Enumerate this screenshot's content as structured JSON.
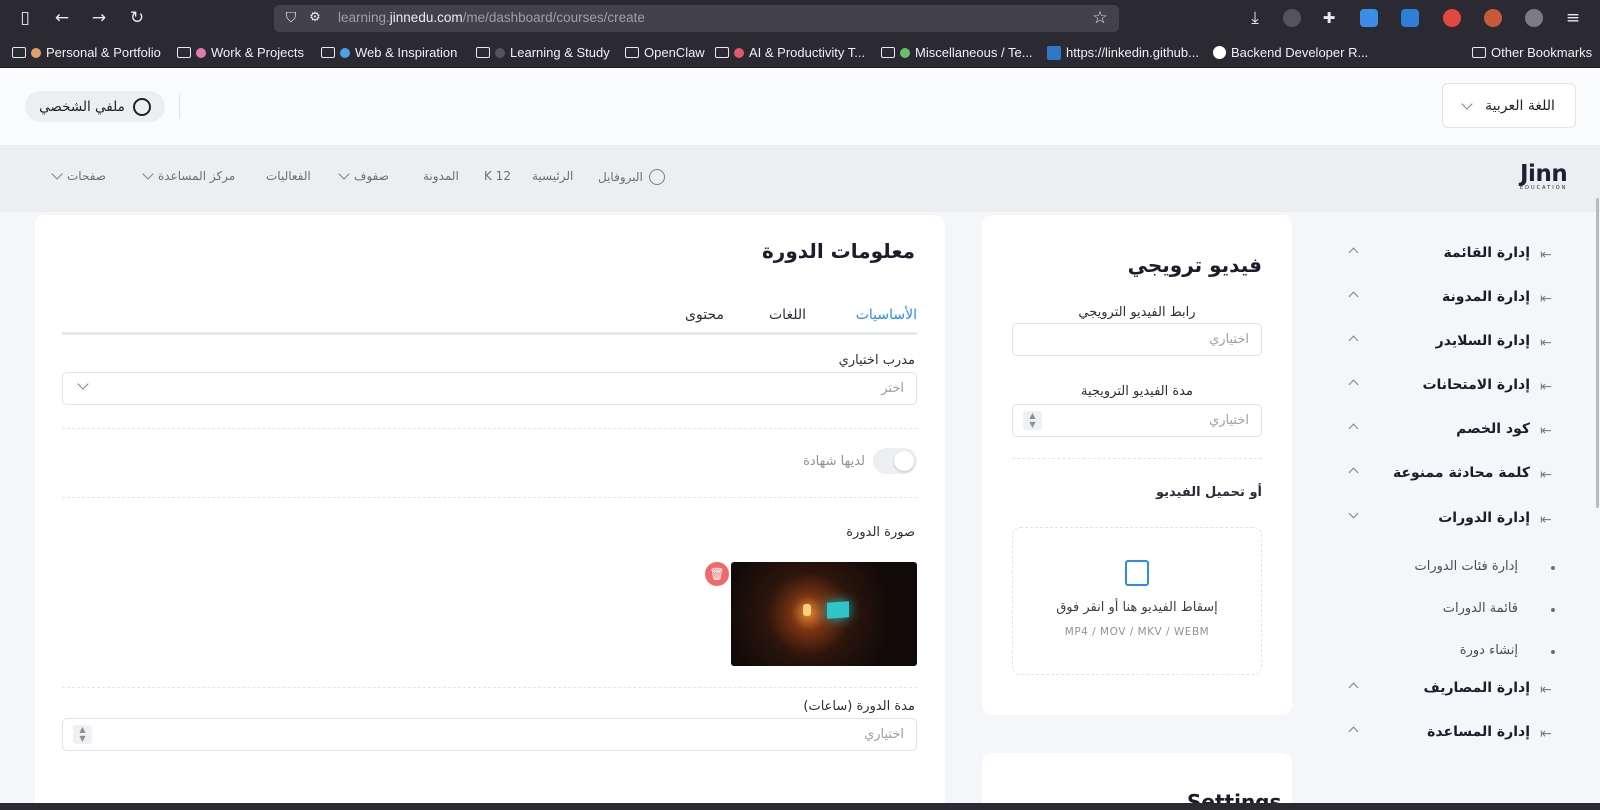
{
  "browser": {
    "url_prefix": "learning.",
    "url_host": "jinnedu.com",
    "url_path": "/me/dashboard/courses/create",
    "bookmarks": [
      "Personal & Portfolio",
      "Work & Projects",
      "Web & Inspiration",
      "Learning & Study",
      "OpenClaw",
      "AI & Productivity T...",
      "Miscellaneous / Te...",
      "https://linkedin.github...",
      "Backend Developer R...",
      "Other Bookmarks"
    ]
  },
  "topbar": {
    "profile_label": "ملفي الشخصي",
    "language_label": "اللغة العربية"
  },
  "nav": {
    "items": [
      "صفحات",
      "مركز المساعدة",
      "الفعاليات",
      "صفوف",
      "المدونة",
      "K 12",
      "الرئيسية",
      "البروفايل"
    ]
  },
  "logo": {
    "text": "Jinn",
    "subtext": "EDUCATION"
  },
  "course_info": {
    "title": "معلومات الدورة",
    "tabs": [
      "الأساسيات",
      "اللغات",
      "محتوى"
    ],
    "active_tab": "الأساسيات",
    "trainer_label": "مدرب اختياري",
    "trainer_placeholder": "اختر",
    "certificate_label": "لديها شهادة",
    "certificate_enabled": false,
    "image_label": "صورة الدورة",
    "duration_label": "مدة الدورة (ساعات)",
    "duration_placeholder": "اختياري"
  },
  "promo_video": {
    "title": "فيديو ترويجي",
    "url_label": "رابط الفيديو الترويجي",
    "url_placeholder": "اختياري",
    "duration_label": "مدة الفيديو الترويجية",
    "duration_placeholder": "اختياري",
    "upload_label": "أو تحميل الفيديو",
    "drop_text": "إسقاط الفيديو هنا أو انقر فوق",
    "formats": "MP4 / MOV / MKV / WEBM"
  },
  "settings_card": {
    "title": "Settings"
  },
  "sidebar": {
    "items": [
      {
        "label": "إدارة القائمة",
        "expanded": false
      },
      {
        "label": "إدارة المدونة",
        "expanded": false
      },
      {
        "label": "إدارة السلايدر",
        "expanded": false
      },
      {
        "label": "إدارة الامتحانات",
        "expanded": false
      },
      {
        "label": "كود الخصم",
        "expanded": false
      },
      {
        "label": "كلمة محادثة ممنوعة",
        "expanded": false
      },
      {
        "label": "إدارة الدورات",
        "expanded": true
      },
      {
        "label": "إدارة المصاريف",
        "expanded": false
      },
      {
        "label": "إدارة المساعدة",
        "expanded": false
      }
    ],
    "course_subitems": [
      "إدارة فئات الدورات",
      "قائمة الدورات",
      "إنشاء دورة"
    ]
  },
  "colors": {
    "accent": "#2a8cf0",
    "danger": "#ef6a6a",
    "browser_chrome": "#2b2a33"
  }
}
